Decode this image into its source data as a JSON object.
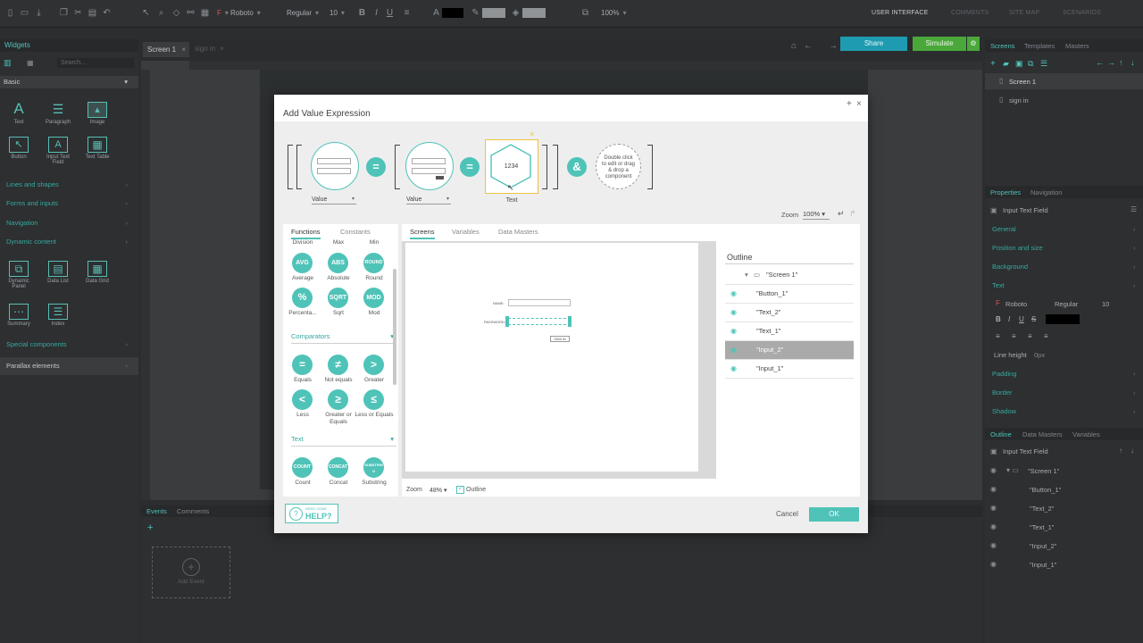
{
  "toolbar": {
    "font": "Roboto",
    "weight": "Regular",
    "size": "10",
    "zoom": "100%",
    "menus": [
      "USER INTERFACE",
      "COMMENTS",
      "SITE MAP",
      "SCENARIOS"
    ]
  },
  "header": {
    "share": "Share",
    "simulate": "Simulate"
  },
  "canvas_tabs": {
    "screen1": "Screen 1",
    "signin": "sign in"
  },
  "widgets_panel": {
    "title": "Widgets",
    "search": "Search...",
    "group": "Basic",
    "basic": [
      "Text",
      "Paragraph",
      "Image",
      "Button",
      "Input Text Field",
      "Text Table"
    ],
    "sections": [
      "Lines and shapes",
      "Forms and inputs",
      "Navigation",
      "Dynamic content"
    ],
    "dynamic": [
      "Dynamic Panel",
      "Data List",
      "Data Grid",
      "Summary",
      "Index"
    ],
    "special": "Special components",
    "parallax": "Parallax elements"
  },
  "events_panel": {
    "tabs": [
      "Events",
      "Comments"
    ],
    "add_event": "Add Event"
  },
  "screens_panel": {
    "tabs": [
      "Screens",
      "Templates",
      "Masters"
    ],
    "items": [
      "Screen 1",
      "sign in"
    ]
  },
  "properties_panel": {
    "tabs": [
      "Properties",
      "Navigation"
    ],
    "title": "Input Text Field",
    "sections": [
      "General",
      "Position and size",
      "Background",
      "Text"
    ],
    "font": "Roboto",
    "weight": "Regular",
    "size": "10",
    "line_height_label": "Line height",
    "line_height_value": "0px",
    "lower_sections": [
      "Padding",
      "Border",
      "Shadow"
    ]
  },
  "outline_panel": {
    "tabs": [
      "Outline",
      "Data Masters",
      "Variables"
    ],
    "title": "Input Text Field",
    "items": [
      "\"Screen 1\"",
      "\"Button_1\"",
      "\"Text_2\"",
      "\"Text_1\"",
      "\"Input_2\"",
      "\"Input_1\""
    ]
  },
  "dialog": {
    "title": "Add Value Expression",
    "value_label_1": "Value",
    "value_label_2": "Value",
    "text_label": "Text",
    "text_value": "1234",
    "op_eq1": "=",
    "op_eq2": "=",
    "op_and": "&",
    "dropzone": "Double click to edit or drag & drop a component",
    "zoom_label": "Zoom",
    "zoom_value": "100%",
    "func_tabs": [
      "Functions",
      "Constants"
    ],
    "math_top": [
      "Division",
      "Max",
      "Min"
    ],
    "math_btns": [
      "AVG",
      "ABS",
      "ROUND",
      "%",
      "SQRT",
      "MOD"
    ],
    "math_labels": [
      "Average",
      "Absolute",
      "Round",
      "Percenta...",
      "Sqrt",
      "Mod"
    ],
    "comparators_title": "Comparators",
    "comp_btns": [
      "=",
      "≠",
      ">",
      "<",
      "≥",
      "≤"
    ],
    "comp_labels": [
      "Equals",
      "Not equals",
      "Greater",
      "Less",
      "Greater or Equals",
      "Less or Equals"
    ],
    "text_title": "Text",
    "text_btns": [
      "COUNT",
      "CONCAT",
      "SUBSTRING"
    ],
    "text_labels": [
      "Count",
      "Concat",
      "Substring"
    ],
    "center_tabs": [
      "Screens",
      "Variables",
      "Data Masters"
    ],
    "preview_name": "NAME:",
    "preview_password": "PASSWORD:",
    "preview_button": "SIGN IN",
    "preview_zoom_label": "Zoom",
    "preview_zoom_value": "48%",
    "preview_outline": "Outline",
    "outline_title": "Outline",
    "outline_screen": "\"Screen 1\"",
    "outline_items": [
      "\"Button_1\"",
      "\"Text_2\"",
      "\"Text_1\"",
      "\"Input_2\"",
      "\"Input_1\""
    ],
    "help_small": "NEED SOME",
    "help_big": "HELP?",
    "cancel": "Cancel",
    "ok": "OK"
  },
  "colors": {
    "accent": "#4fc3b8",
    "share": "#1e9bb0",
    "simulate": "#4aa83a"
  }
}
